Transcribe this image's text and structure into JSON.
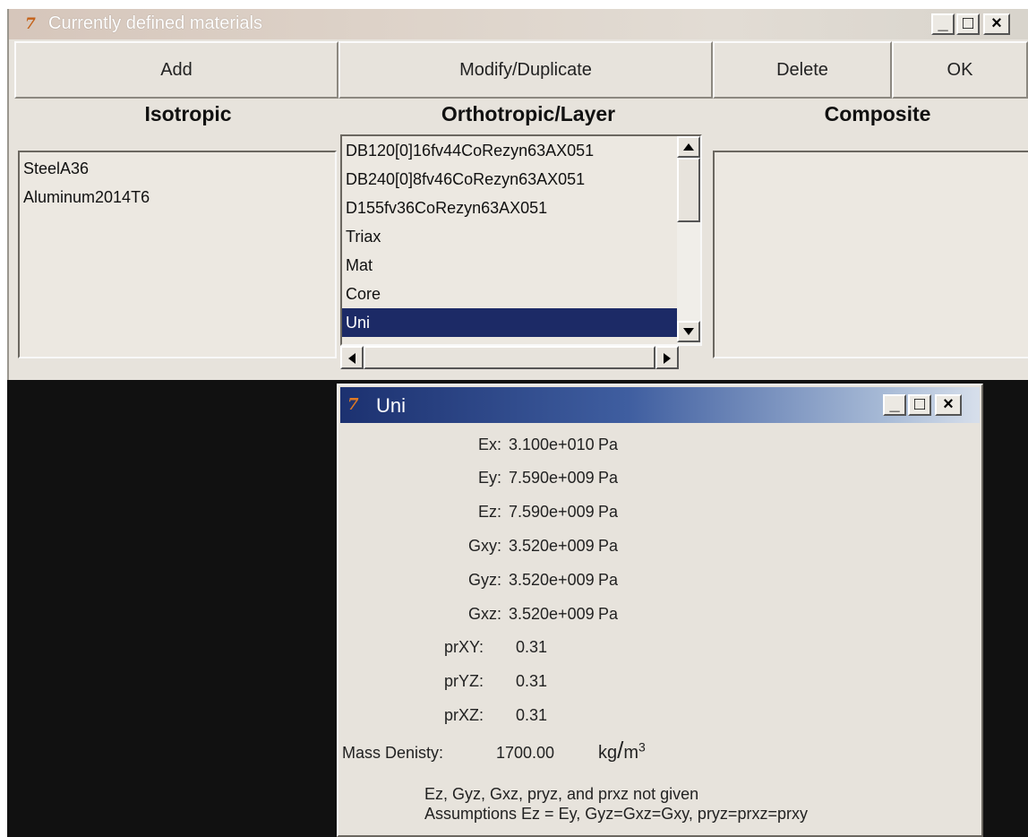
{
  "main_window": {
    "title": "Currently defined materials",
    "controls": {
      "minimize": "_",
      "maximize": "□",
      "close": "×"
    },
    "buttons": {
      "add": "Add",
      "modify": "Modify/Duplicate",
      "delete": "Delete",
      "ok": "OK"
    },
    "columns": {
      "isotropic": "Isotropic",
      "orthotropic": "Orthotropic/Layer",
      "composite": "Composite"
    },
    "isotropic_items": [
      "SteelA36",
      "Aluminum2014T6"
    ],
    "orthotropic_items": [
      "DB120[0]16fv44CoRezyn63AX051",
      "DB240[0]8fv46CoRezyn63AX051",
      "D155fv36CoRezyn63AX051",
      "Triax",
      "Mat",
      "Core",
      "Uni"
    ],
    "orthotropic_selected": "Uni",
    "composite_items": []
  },
  "uni_window": {
    "title": "Uni",
    "controls": {
      "minimize": "_",
      "maximize": "□",
      "close": "×"
    },
    "properties": [
      {
        "label": "Ex:",
        "value": "3.100e+010",
        "unit": "Pa"
      },
      {
        "label": "Ey:",
        "value": "7.590e+009",
        "unit": "Pa"
      },
      {
        "label": "Ez:",
        "value": "7.590e+009",
        "unit": "Pa"
      },
      {
        "label": "Gxy:",
        "value": "3.520e+009",
        "unit": "Pa"
      },
      {
        "label": "Gyz:",
        "value": "3.520e+009",
        "unit": "Pa"
      },
      {
        "label": "Gxz:",
        "value": "3.520e+009",
        "unit": "Pa"
      },
      {
        "label": "prXY:",
        "value": "0.31",
        "unit": ""
      },
      {
        "label": "prYZ:",
        "value": "0.31",
        "unit": ""
      },
      {
        "label": "prXZ:",
        "value": "0.31",
        "unit": ""
      }
    ],
    "density": {
      "label": "Mass Denisty:",
      "value": "1700.00",
      "unit_num": "kg",
      "unit_den": "m",
      "unit_exp": "3"
    },
    "notes": [
      "Ez, Gyz, Gxz, pryz, and prxz not given",
      "Assumptions Ez = Ey, Gyz=Gxz=Gxy, pryz=prxz=prxy"
    ]
  },
  "colors": {
    "selection": "#1c2a66",
    "face": "#e7e3dc",
    "uni_title": "#1c3170"
  }
}
